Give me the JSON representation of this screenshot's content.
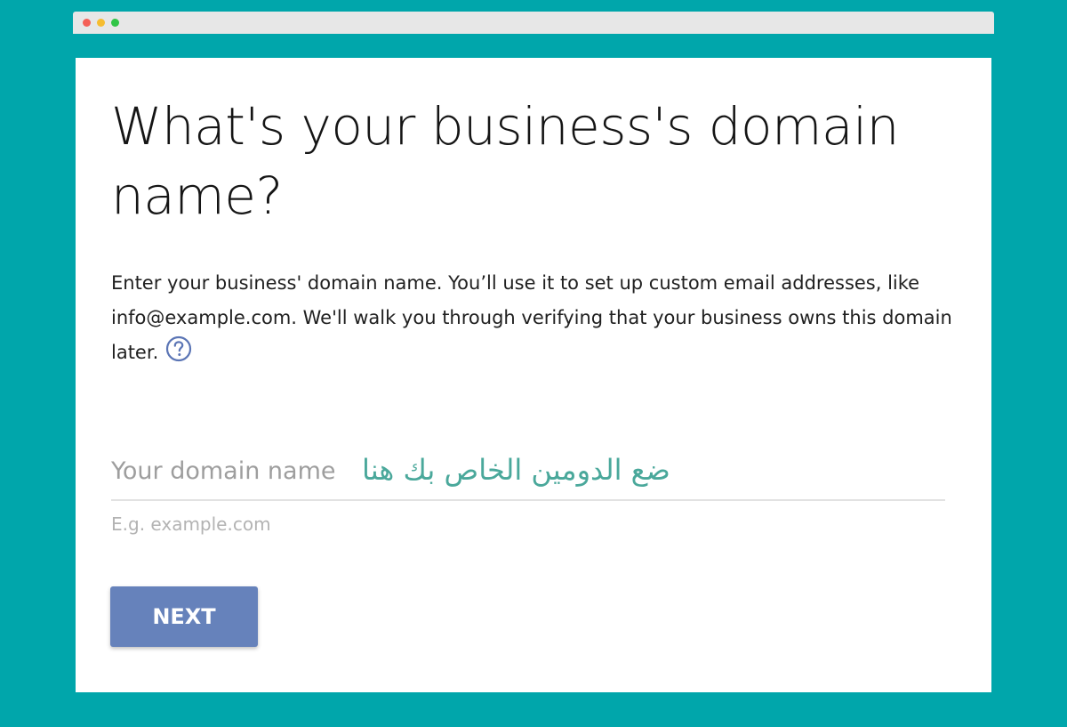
{
  "colors": {
    "background": "#00a6ab",
    "accent": "#6682bb",
    "arabic_text": "#4aa89b",
    "help_icon": "#5b75b5"
  },
  "window": {
    "controls": [
      "close-dot",
      "minimize-dot",
      "maximize-dot"
    ]
  },
  "page": {
    "title": "What's your business's domain name?",
    "description": "Enter your business' domain name. You’ll use it to set up custom email addresses, like info@example.com. We'll walk you through verifying that your business owns this domain later.",
    "help_icon": "question-circle-icon"
  },
  "domain_field": {
    "label": "Your domain name",
    "value": "",
    "arabic_hint": "ضع الدومين الخاص بك هنا",
    "helper": "E.g. example.com"
  },
  "buttons": {
    "next_label": "NEXT"
  }
}
